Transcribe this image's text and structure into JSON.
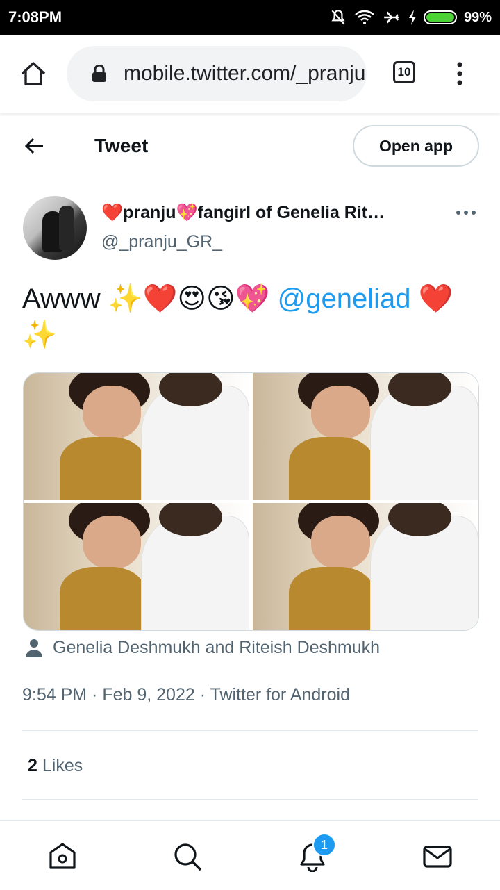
{
  "status_bar": {
    "time": "7:08PM",
    "battery": "99%",
    "icons": [
      "mute-icon",
      "wifi-icon",
      "airplane-icon",
      "charging-icon",
      "battery-icon"
    ]
  },
  "browser": {
    "url": "mobile.twitter.com/_pranju_GR_",
    "tab_count": "10",
    "icons": [
      "home-icon",
      "lock-icon",
      "more-vertical-icon"
    ]
  },
  "header": {
    "title": "Tweet",
    "open_app_label": "Open app"
  },
  "tweet": {
    "display_name": "❤️pranju💖fangirl of Genelia Rit…",
    "handle": "@_pranju_GR_",
    "text_prefix": "Awww ✨❤️😍😘💖 ",
    "mention": "@geneliad",
    "text_suffix": " ❤️✨",
    "tagged_people": "Genelia Deshmukh and Riteish Deshmukh",
    "meta": "9:54 PM · Feb 9, 2022 · Twitter for Android",
    "likes_count": "2",
    "likes_label": "Likes"
  },
  "bottom_nav": {
    "notification_badge": "1",
    "items": [
      "home-icon",
      "search-icon",
      "notifications-icon",
      "messages-icon"
    ]
  },
  "colors": {
    "accent": "#1d9bf0",
    "secondary_text": "#536471",
    "primary_text": "#0f1419"
  }
}
